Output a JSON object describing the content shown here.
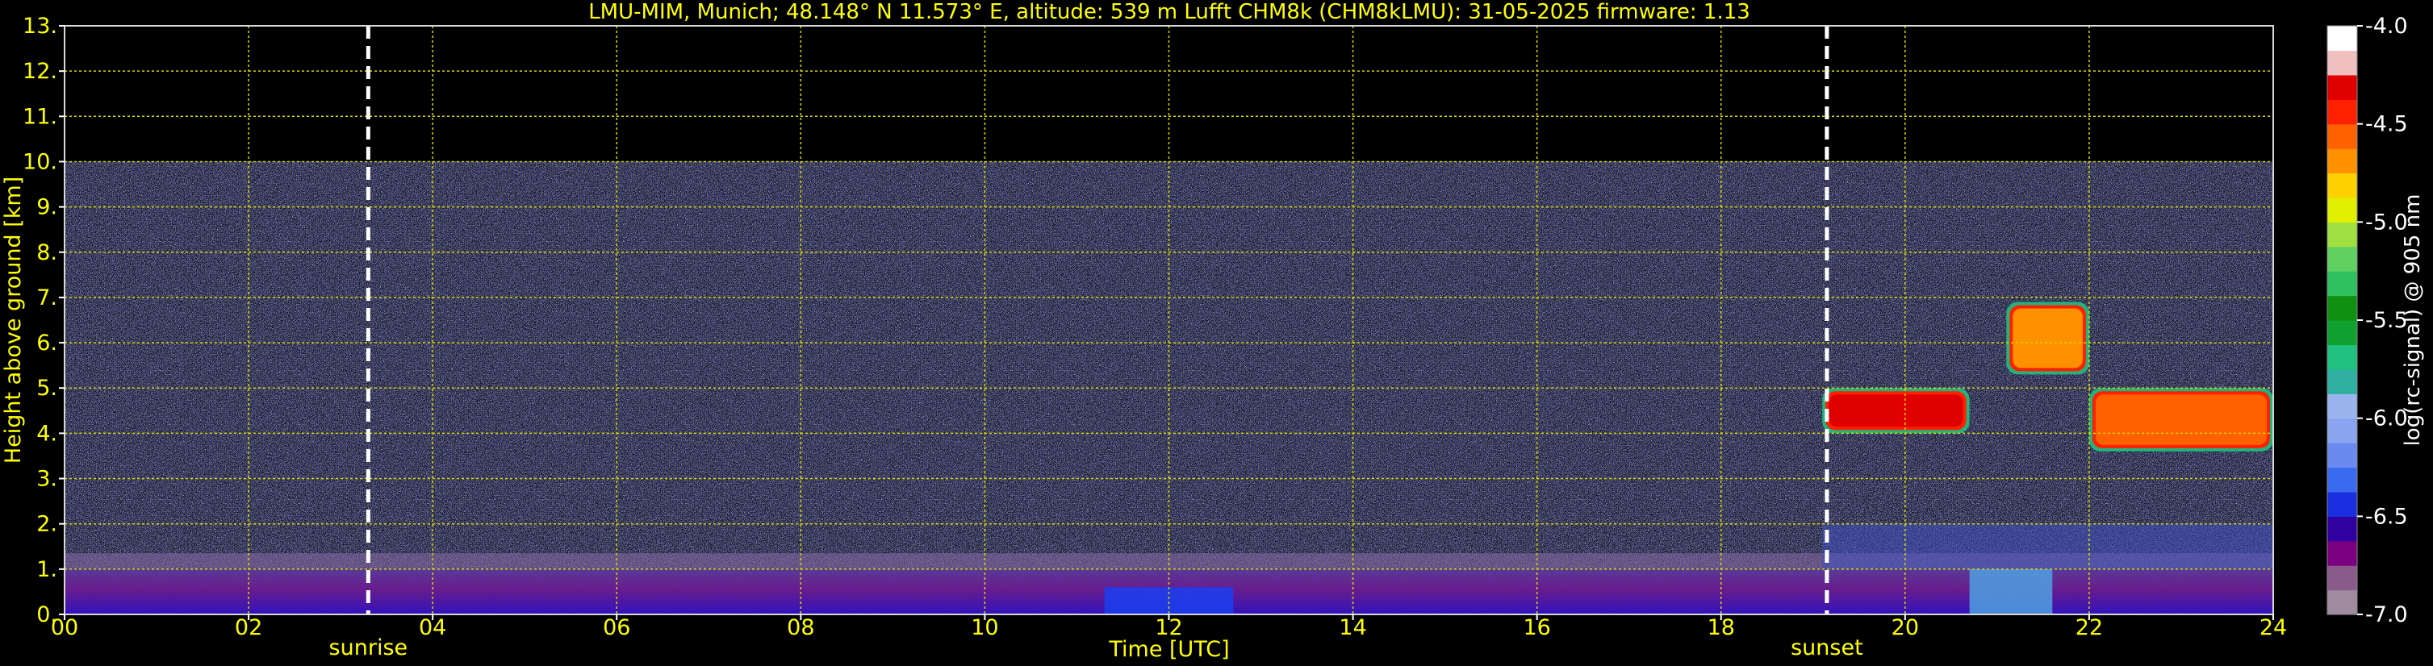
{
  "chart_data": {
    "type": "heatmap",
    "title": "LMU-MIM, Munich; 48.148° N 11.573° E, altitude: 539 m    Lufft CHM8k (CHM8kLMU): 31-05-2025    firmware: 1.13",
    "xlabel": "Time [UTC]",
    "ylabel": "Height above ground [km]",
    "xlim": [
      0,
      24
    ],
    "ylim": [
      0,
      13
    ],
    "x_tick_labels": [
      "00",
      "02",
      "04",
      "06",
      "08",
      "10",
      "12",
      "14",
      "16",
      "18",
      "20",
      "22",
      "24"
    ],
    "y_tick_labels": [
      "0.",
      "1.",
      "2.",
      "3.",
      "4.",
      "5.",
      "6.",
      "7.",
      "8.",
      "9.",
      "10.",
      "11.",
      "12.",
      "13."
    ],
    "grid": true,
    "data_top_height_km": 10,
    "markers": [
      {
        "label": "sunrise",
        "time": 3.3
      },
      {
        "label": "sunset",
        "time": 19.15
      }
    ],
    "colorbar": {
      "label": "log(rc-signal) @ 905 nm",
      "range": [
        -7.0,
        -4.0
      ],
      "tick_labels": [
        "-4.0",
        "-4.5",
        "-5.0",
        "-5.5",
        "-6.0",
        "-6.5",
        "-7.0"
      ],
      "tick_values": [
        -4.0,
        -4.5,
        -5.0,
        -5.5,
        -6.0,
        -6.5,
        -7.0
      ],
      "colors": [
        "#a08aa0",
        "#8a5a8a",
        "#7a0080",
        "#3000a0",
        "#1a30e0",
        "#3a6af0",
        "#6a8af0",
        "#8aa4f0",
        "#9ab4f0",
        "#30b0a0",
        "#20c080",
        "#10a030",
        "#109010",
        "#30c060",
        "#60d060",
        "#a0e040",
        "#e0f000",
        "#ffd000",
        "#ff9000",
        "#ff6000",
        "#ff2000",
        "#e00000",
        "#f0c0c0",
        "#ffffff"
      ]
    },
    "features": [
      {
        "name": "boundary layer",
        "time_range": [
          0,
          24
        ],
        "height_range": [
          0,
          1.0
        ],
        "level": -6.4
      },
      {
        "name": "cloud layer",
        "time_range": [
          19.1,
          20.7
        ],
        "height_range": [
          4.0,
          5.0
        ],
        "level": -4.3
      },
      {
        "name": "cloud layer",
        "time_range": [
          22.0,
          24.0
        ],
        "height_range": [
          3.6,
          5.0
        ],
        "level": -4.5
      },
      {
        "name": "cloud layer",
        "time_range": [
          21.1,
          22.0
        ],
        "height_range": [
          5.3,
          6.9
        ],
        "level": -4.6
      }
    ]
  }
}
